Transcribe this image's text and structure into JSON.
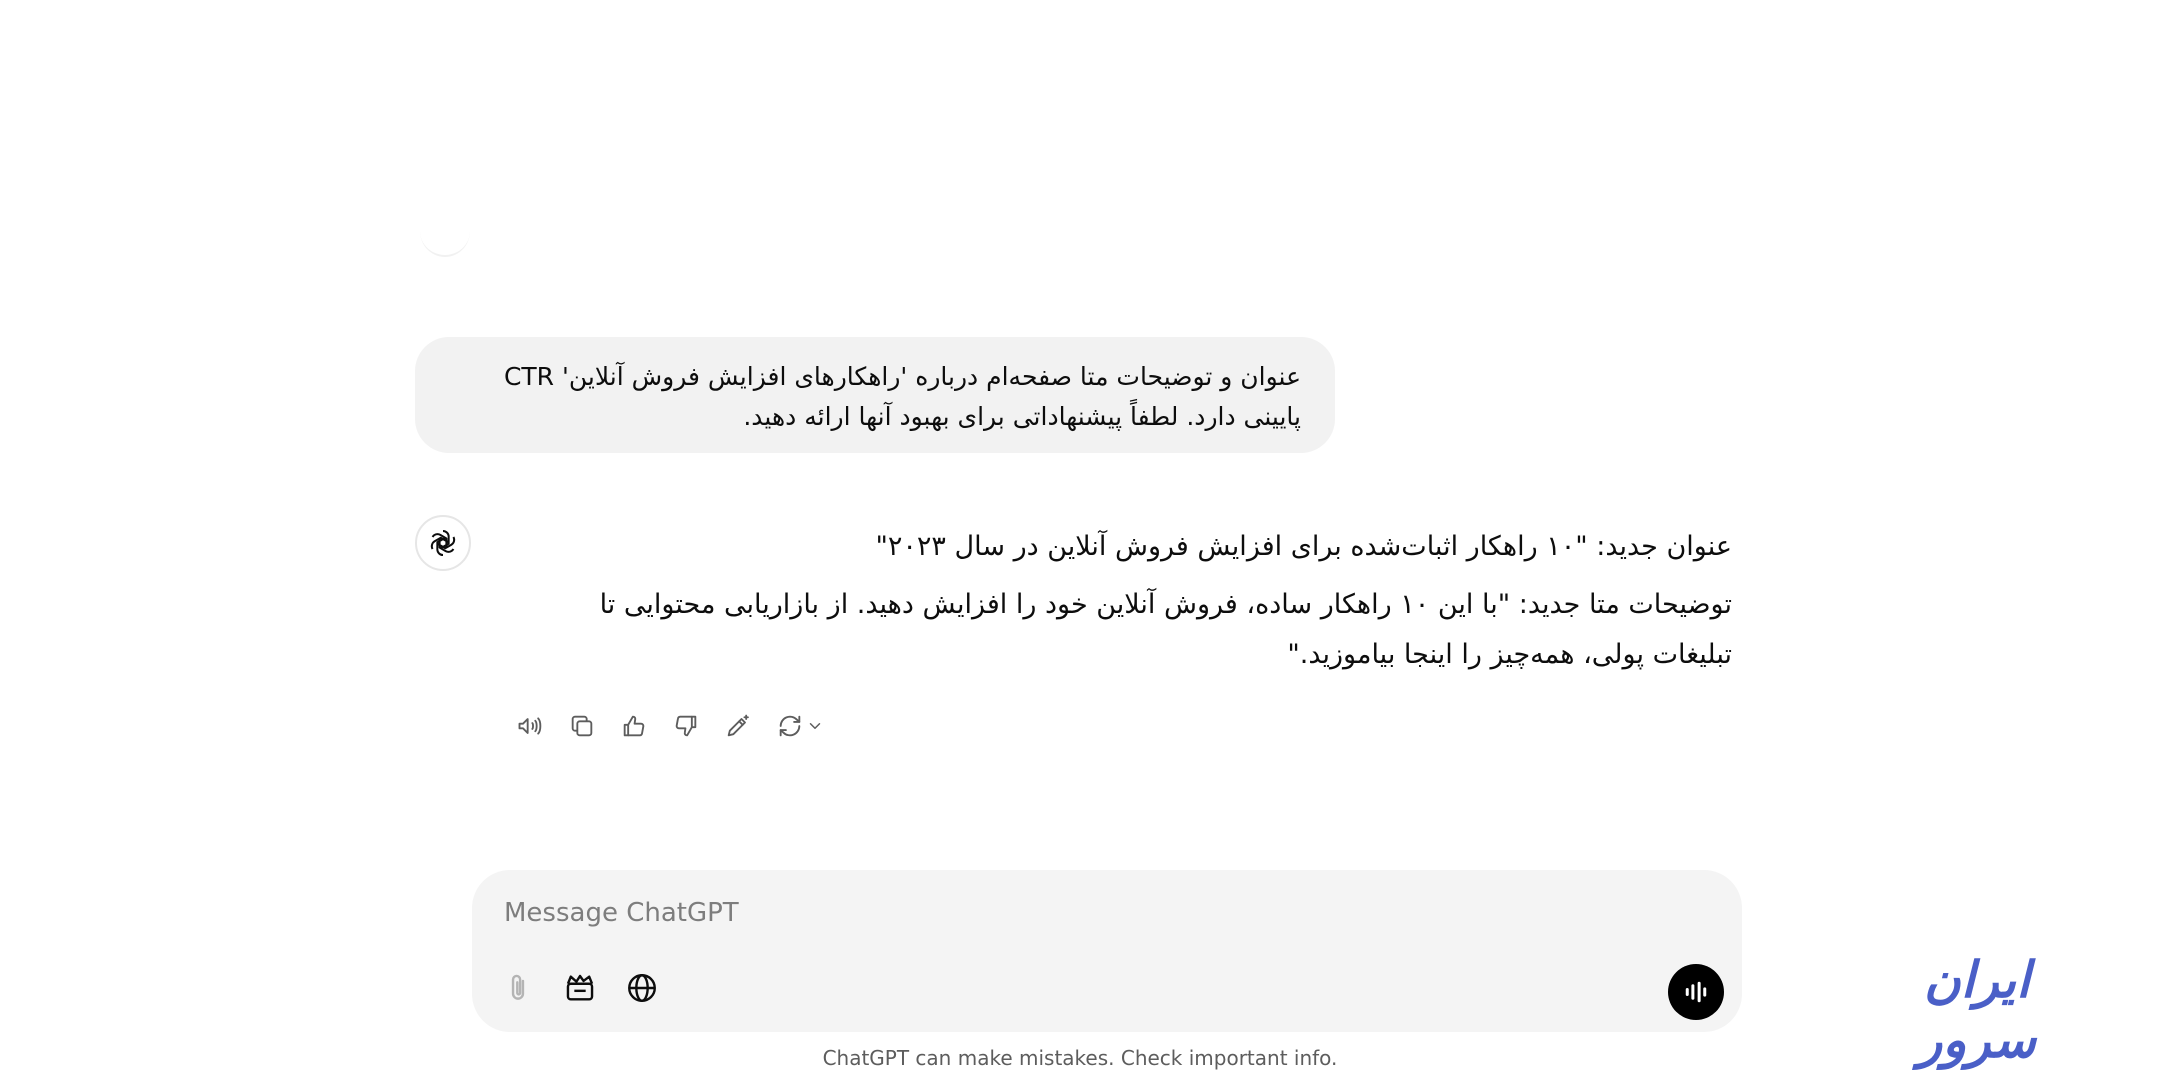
{
  "conversation": {
    "user_message": "عنوان و توضیحات متا صفحه‌ام درباره 'راهکارهای افزایش فروش آنلاین' CTR پایینی دارد. لطفاً پیشنهاداتی برای بهبود آنها ارائه دهید.",
    "assistant_paragraphs": [
      "عنوان جدید: \"۱۰ راهکار اثبات‌شده برای افزایش فروش آنلاین در سال ۲۰۲۳\"",
      "توضیحات متا جدید: \"با این ۱۰ راهکار ساده، فروش آنلاین خود را افزایش دهید. از بازاریابی محتوایی تا تبلیغات پولی، همه‌چیز را اینجا بیاموزید.\""
    ]
  },
  "message_actions": {
    "icons": [
      "speaker-icon",
      "copy-icon",
      "thumbs-up-icon",
      "thumbs-down-icon",
      "edit-canvas-icon",
      "regenerate-icon",
      "chevron-down-icon"
    ]
  },
  "composer": {
    "placeholder": "Message ChatGPT",
    "value": "",
    "tool_icons": [
      "paperclip-icon",
      "tools-icon",
      "globe-icon",
      "voice-mode-icon"
    ]
  },
  "footer": {
    "disclaimer": "ChatGPT can make mistakes. Check important info."
  },
  "watermark": {
    "text": "ایران سرور",
    "color": "#4a5fc7"
  }
}
